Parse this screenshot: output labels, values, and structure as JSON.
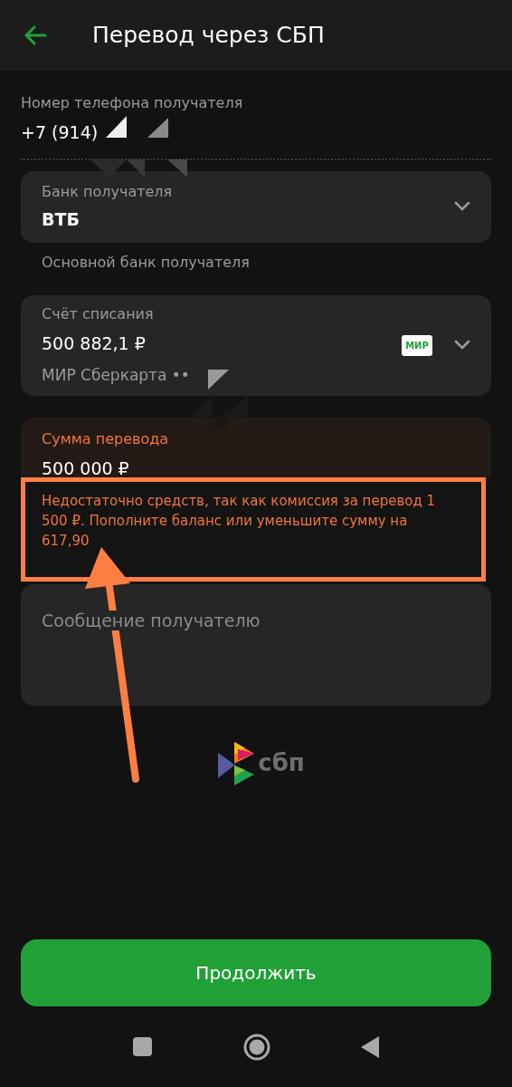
{
  "header": {
    "back_icon": true,
    "title": "Перевод через СБП"
  },
  "phone": {
    "label": "Номер телефона получателя",
    "value": "+7 (914)"
  },
  "bank": {
    "label": "Банк получателя",
    "value": "ВТБ",
    "hint": "Основной банк получателя"
  },
  "account": {
    "label": "Счёт списания",
    "balance": "500 882,1 ₽",
    "card": "МИР Сберкарта ••",
    "card_badge": "МИР"
  },
  "amount": {
    "label": "Сумма перевода",
    "value": "500 000 ₽",
    "error": true,
    "error_text": "Недостаточно средств, так как комиссия за перевод 1 500 ₽. Пополните баланс или уменьшите сумму на 617,90"
  },
  "message": {
    "placeholder": "Сообщение получателю"
  },
  "logo": {
    "text": "сбп"
  },
  "continue_button": "Продолжить"
}
